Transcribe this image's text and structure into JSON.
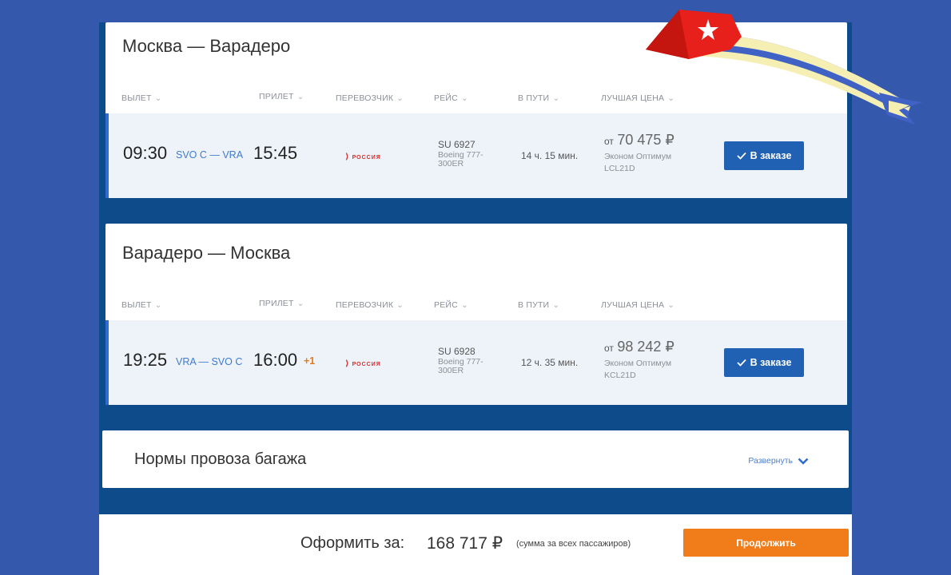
{
  "columns": {
    "departure": "ВЫЛЕТ",
    "arrival": "ПРИЛЕТ",
    "carrier": "ПЕРЕВОЗЧИК",
    "flight": "РЕЙС",
    "duration": "В ПУТИ",
    "best_price": "ЛУЧШАЯ ЦЕНА",
    "caret": "⌄"
  },
  "outbound": {
    "title": "Москва — Варадеро",
    "dep_time": "09:30",
    "route": "SVO C — VRA",
    "arr_time": "15:45",
    "carrier_name": "РОССИЯ",
    "flight_no": "SU 6927",
    "aircraft": "Boeing 777-300ER",
    "duration": "14 ч. 15 мин.",
    "price_from": "от",
    "price": "70 475 ₽",
    "fare_name": "Эконом Оптимум",
    "fare_code": "LCL21D",
    "button": "В заказе"
  },
  "inbound": {
    "title": "Варадеро — Москва",
    "dep_time": "19:25",
    "route": "VRA — SVO C",
    "arr_time": "16:00",
    "next_day": "+1",
    "carrier_name": "РОССИЯ",
    "flight_no": "SU 6928",
    "aircraft": "Boeing 777-300ER",
    "duration": "12 ч. 35 мин.",
    "price_from": "от",
    "price": "98 242 ₽",
    "fare_name": "Эконом Оптимум",
    "fare_code": "KCL21D",
    "button": "В заказе"
  },
  "baggage": {
    "title": "Нормы провоза багажа",
    "expand": "Развернуть"
  },
  "footer": {
    "total_label": "Оформить за:",
    "total_amount": "168 717 ₽",
    "total_note": "(сумма за всех пассажиров)",
    "continue": "Продолжить"
  },
  "colors": {
    "background": "#3458ab",
    "panel": "#0e4b8b",
    "accent_blue": "#2161b3",
    "accent_orange": "#f07d1a",
    "flag_red": "#e8201c",
    "flag_blue": "#3f62c4",
    "flag_cream": "#f6efb4"
  },
  "icons": {
    "check": "check-icon",
    "chevron": "chevron-down-icon",
    "flag": "cuban-flag-ribbon-icon"
  }
}
